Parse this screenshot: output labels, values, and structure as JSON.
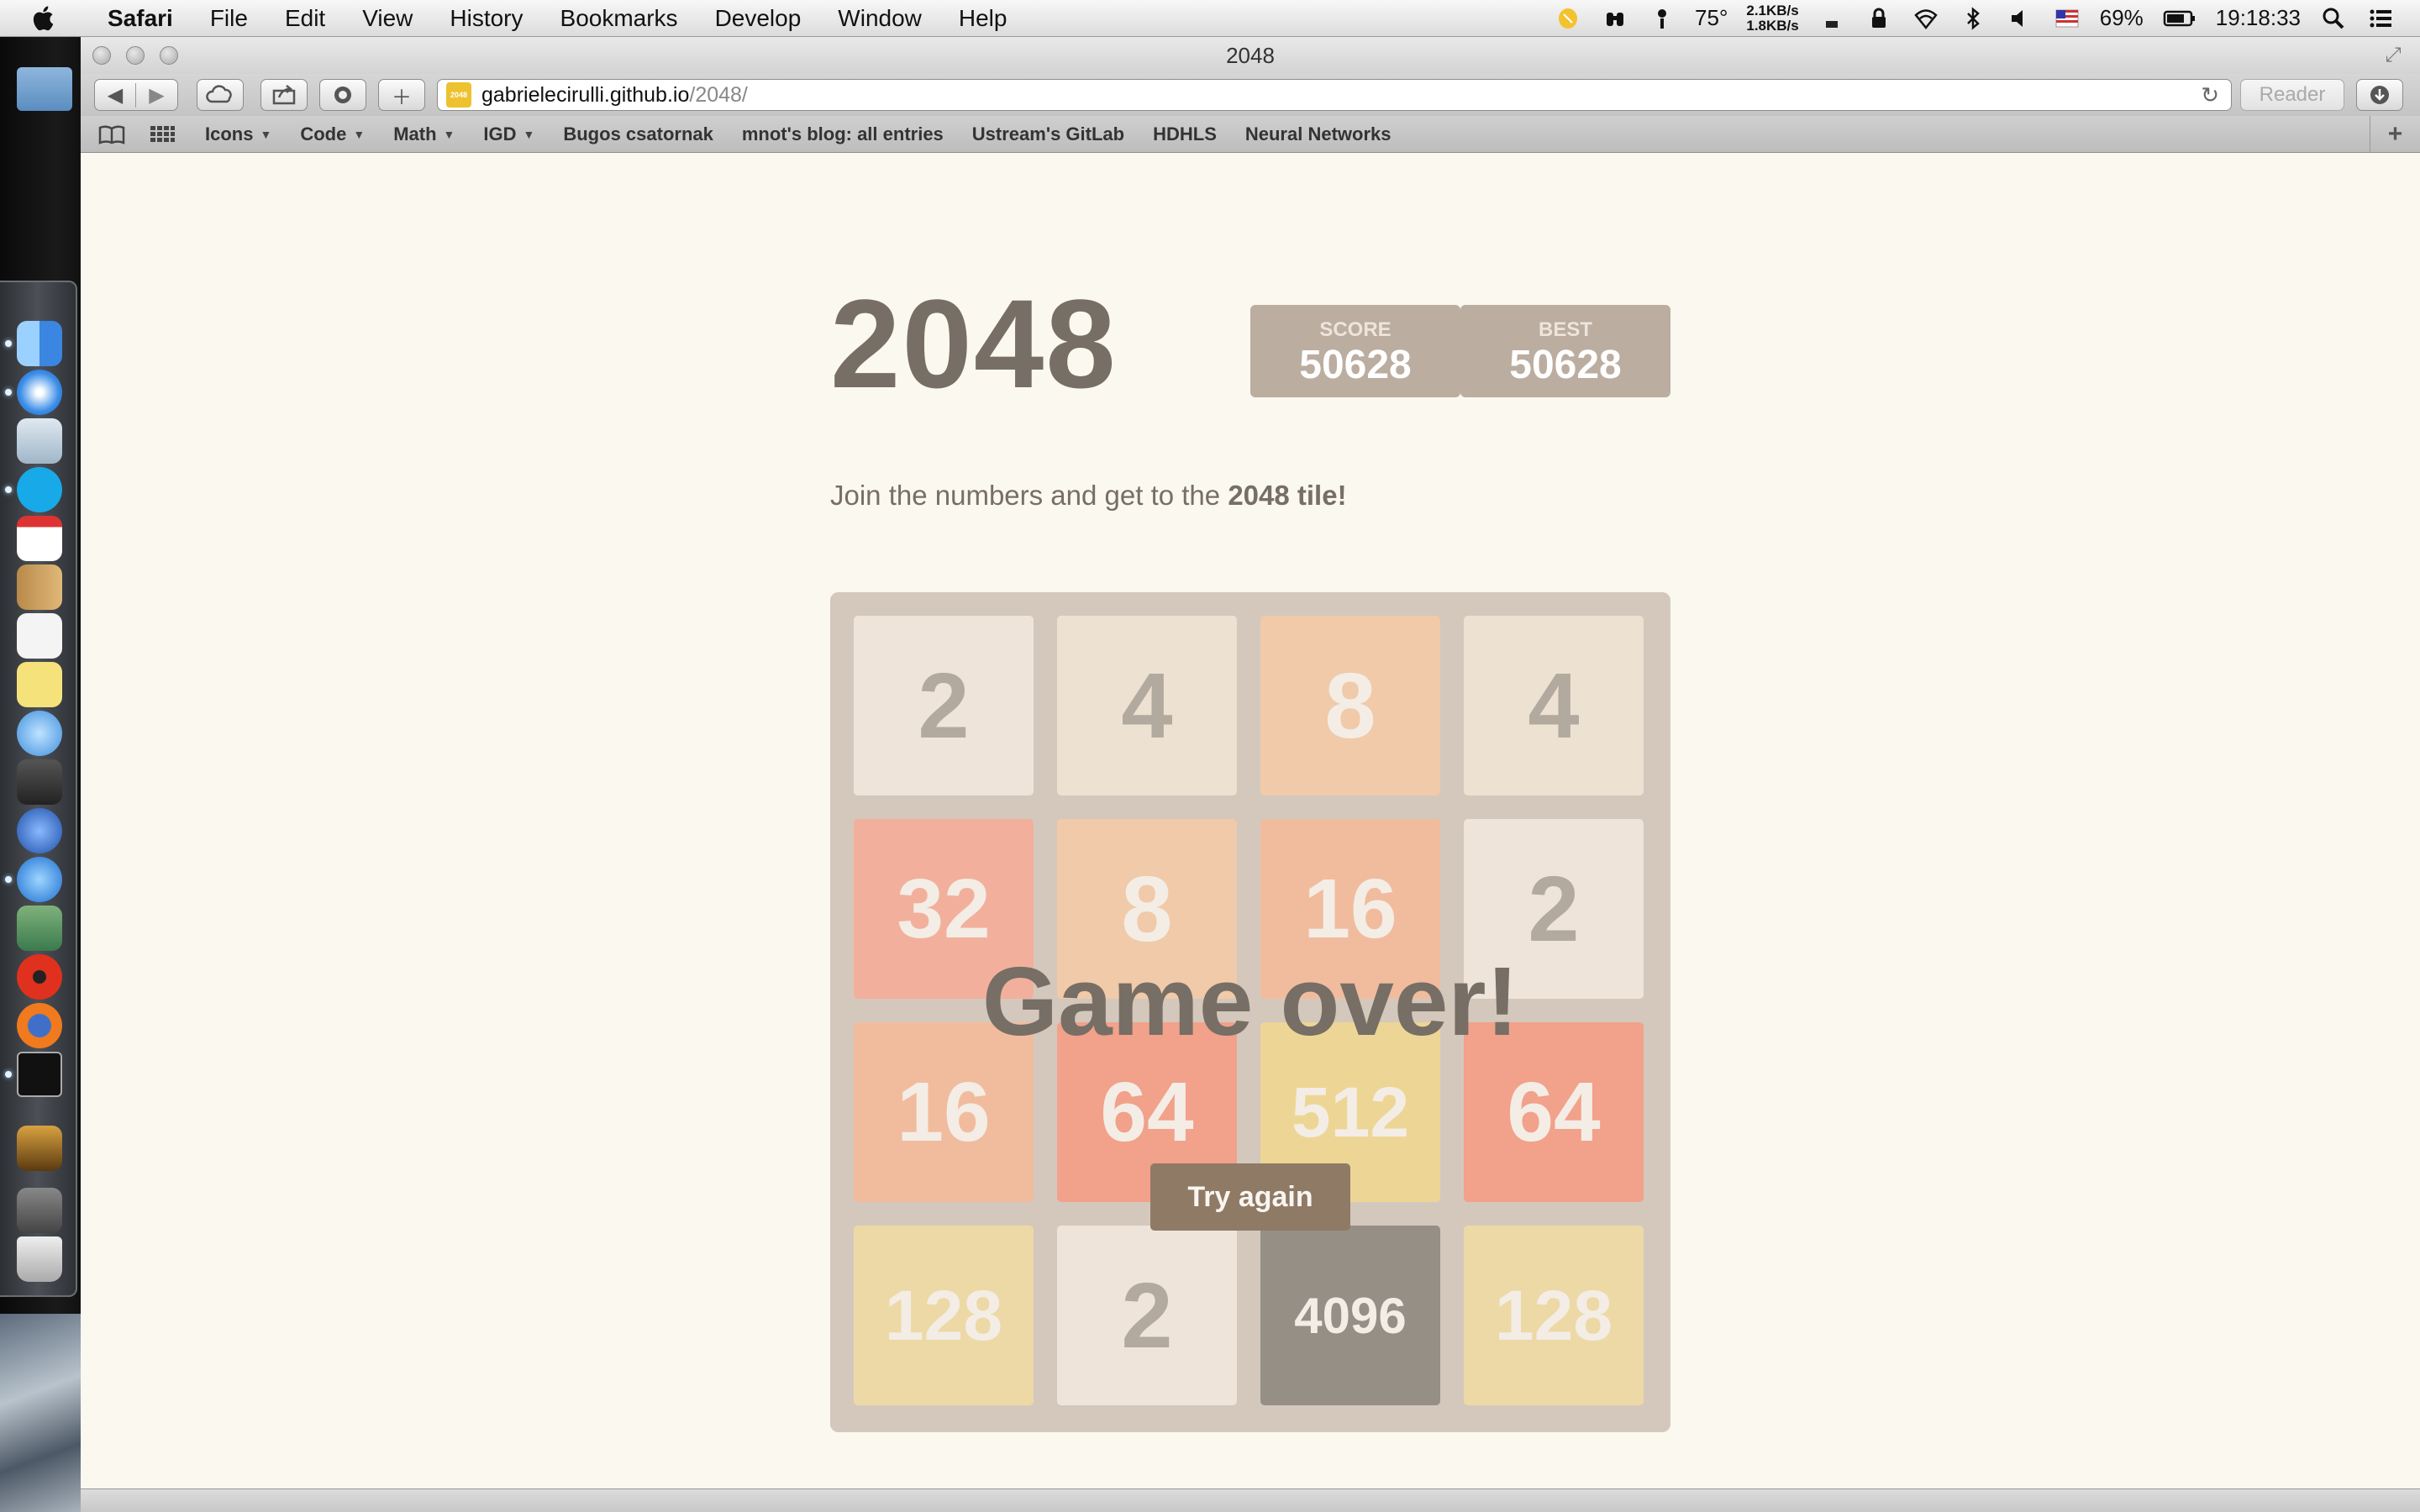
{
  "menubar": {
    "app": "Safari",
    "items": [
      "File",
      "Edit",
      "View",
      "History",
      "Bookmarks",
      "Develop",
      "Window",
      "Help"
    ],
    "temperature": "75°",
    "net_up": "2.1KB/s",
    "net_down": "1.8KB/s",
    "battery": "69%",
    "clock": "19:18:33"
  },
  "window": {
    "title": "2048",
    "url_host": "gabrielecirulli.github.io",
    "url_path": "/2048/",
    "favicon_text": "2048",
    "reader_label": "Reader"
  },
  "bookmarks": {
    "items": [
      {
        "label": "Icons",
        "menu": true
      },
      {
        "label": "Code",
        "menu": true
      },
      {
        "label": "Math",
        "menu": true
      },
      {
        "label": "IGD",
        "menu": true
      },
      {
        "label": "Bugos csatornak",
        "menu": false
      },
      {
        "label": "mnot's blog: all entries",
        "menu": false
      },
      {
        "label": "Ustream's GitLab",
        "menu": false
      },
      {
        "label": "HDHLS",
        "menu": false
      },
      {
        "label": "Neural Networks",
        "menu": false
      }
    ]
  },
  "game": {
    "title": "2048",
    "score_label": "SCORE",
    "score": "50628",
    "best_label": "BEST",
    "best": "50628",
    "intro_prefix": "Join the numbers and get to the ",
    "intro_bold": "2048 tile!",
    "game_over_text": "Game over!",
    "retry_label": "Try again",
    "grid": [
      [
        2,
        4,
        8,
        4
      ],
      [
        32,
        8,
        16,
        2
      ],
      [
        16,
        64,
        512,
        64
      ],
      [
        128,
        2,
        4096,
        128
      ]
    ]
  },
  "colors": {
    "background": "#faf8ef",
    "board": "#bbada0",
    "text_dark": "#776e65",
    "button": "#8f7a66"
  }
}
